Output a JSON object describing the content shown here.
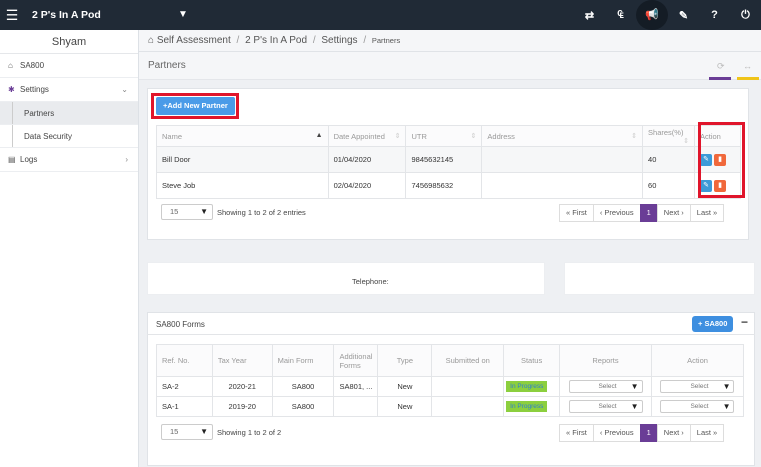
{
  "topbar": {
    "app_title": "2 P's In A Pod",
    "icons": [
      "menu-icon",
      "chevron-down-icon",
      "switch-icon",
      "currency-icon",
      "megaphone-icon",
      "ticket-icon",
      "help-icon",
      "power-icon"
    ],
    "bg": "#202a36"
  },
  "sidebar": {
    "user": "Shyam",
    "items": [
      {
        "label": "SA800"
      },
      {
        "label": "Settings"
      },
      {
        "label": "Partners"
      },
      {
        "label": "Data Security"
      },
      {
        "label": "Logs"
      }
    ]
  },
  "breadcrumb": {
    "c1": "Self Assessment",
    "c2": "2 P's In A Pod",
    "c3": "Settings",
    "c4": "Partners",
    "sep": "/"
  },
  "page": {
    "title": "Partners"
  },
  "partners": {
    "add_label": "+Add New Partner",
    "columns": [
      "Name",
      "Date Appointed",
      "UTR",
      "Address",
      "Shares(%)",
      "Action"
    ],
    "rows": [
      {
        "name": "Bill Door",
        "date": "01/04/2020",
        "utr": "9845632145",
        "address": "",
        "shares": "40"
      },
      {
        "name": "Steve Job",
        "date": "02/04/2020",
        "utr": "7456985632",
        "address": "",
        "shares": "60"
      }
    ],
    "page_size": "15",
    "info": "Showing 1 to 2 of 2 entries",
    "pager": {
      "first": "« First",
      "prev": "‹ Previous",
      "page": "1",
      "next": "Next ›",
      "last": "Last »"
    }
  },
  "contact": {
    "telephone_label": "Telephone:"
  },
  "sa800": {
    "title": "SA800 Forms",
    "add_label": "+ SA800",
    "collapse": "−",
    "columns": [
      "Ref. No.",
      "Tax Year",
      "Main Form",
      "Additional Forms",
      "Type",
      "Submitted on",
      "Status",
      "Reports",
      "Action"
    ],
    "rows": [
      {
        "ref": "SA-2",
        "year": "2020-21",
        "main": "SA800",
        "additional": "SA801, ...",
        "type": "New",
        "submitted": "",
        "status": "In Progress",
        "reports": "Select",
        "action": "Select"
      },
      {
        "ref": "SA-1",
        "year": "2019-20",
        "main": "SA800",
        "additional": "",
        "type": "New",
        "submitted": "",
        "status": "In Progress",
        "reports": "Select",
        "action": "Select"
      }
    ],
    "page_size": "15",
    "info": "Showing 1 to 2 of 2",
    "pager": {
      "first": "« First",
      "prev": "‹ Previous",
      "page": "1",
      "next": "Next ›",
      "last": "Last »"
    }
  },
  "colors": {
    "accent_blue": "#4a9be8",
    "highlight_red": "#e0152b",
    "pager_active": "#6a3d96",
    "status_green": "#8ccf3e",
    "tab_purple": "#6a3d96",
    "tab_yellow": "#f0c419"
  }
}
